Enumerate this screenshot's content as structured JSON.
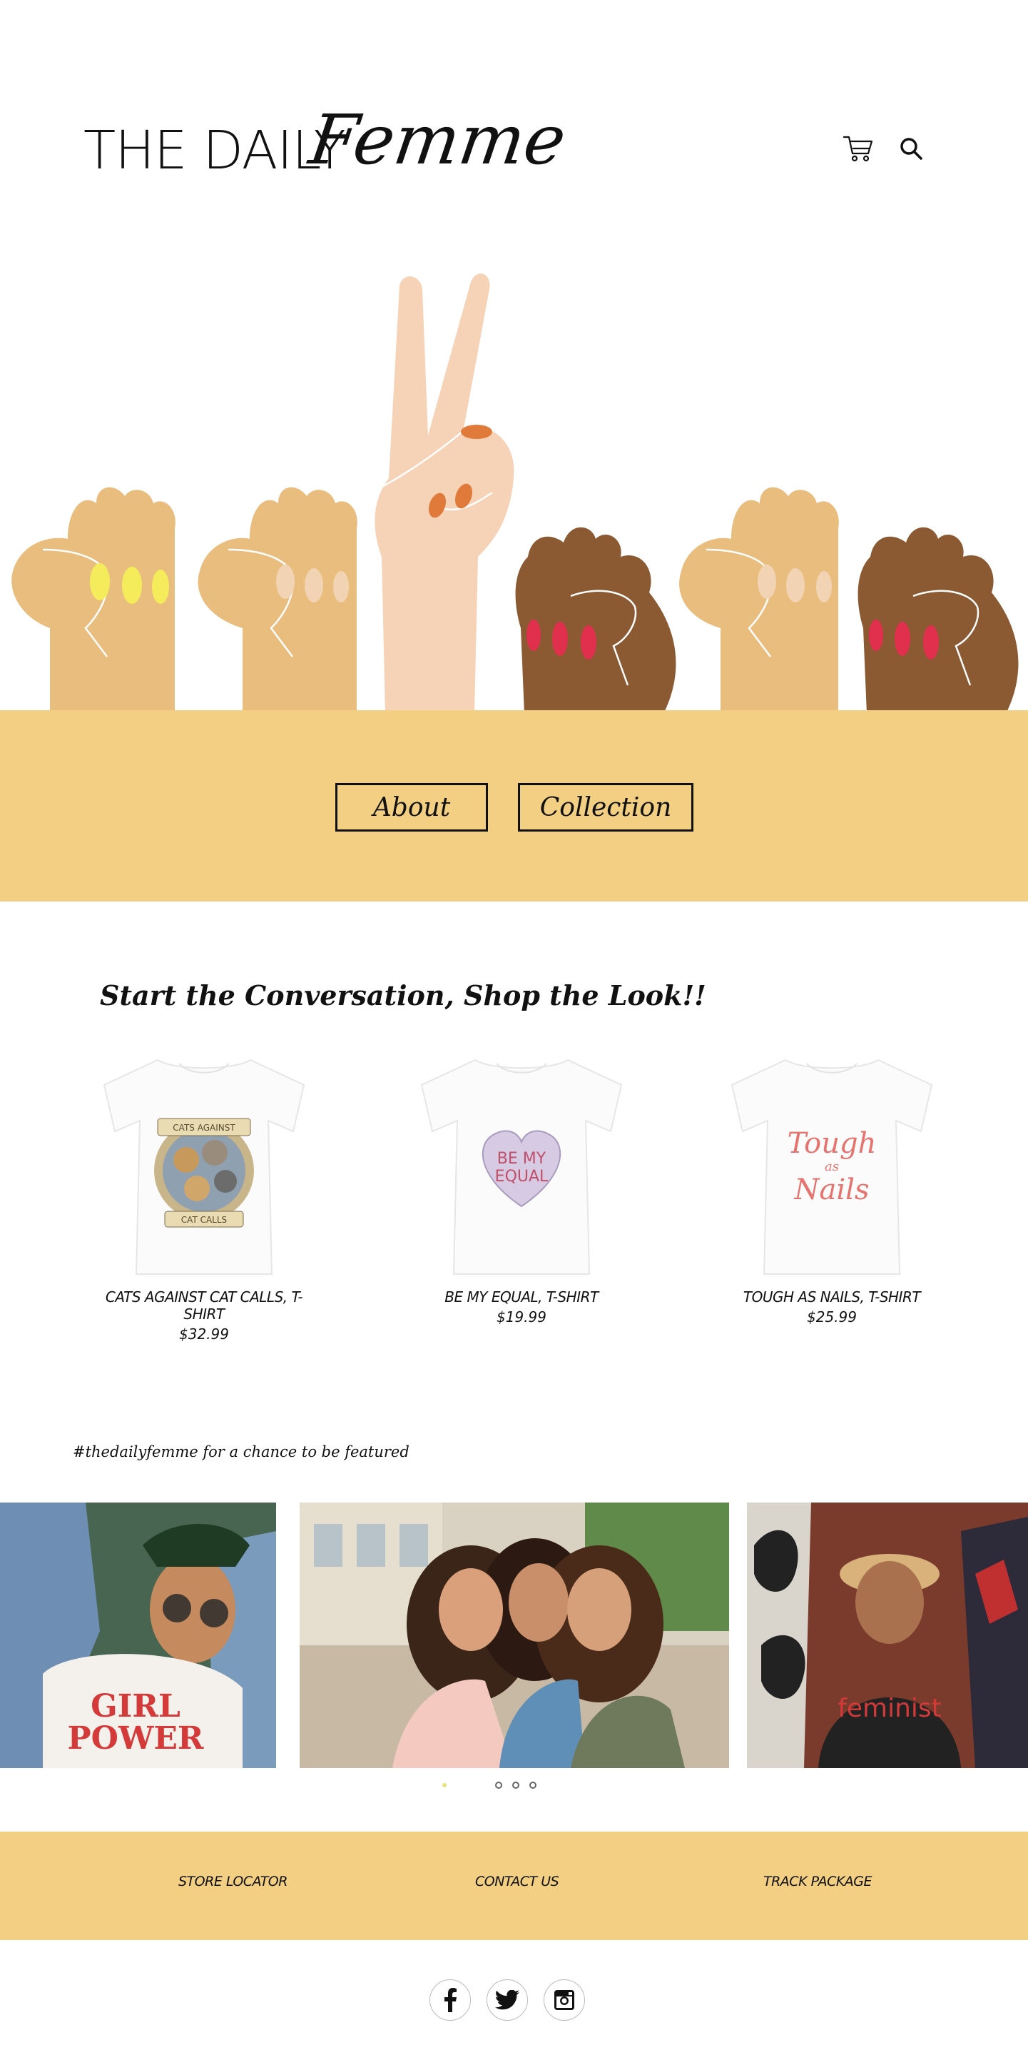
{
  "brand": {
    "logo_sans": "THE DAILY",
    "logo_script": "Femme"
  },
  "header": {
    "icons": [
      "cart-icon",
      "search-icon"
    ]
  },
  "colors": {
    "accent_band": "#f2cf82",
    "text": "#111111"
  },
  "band": {
    "about_label": "About",
    "collection_label": "Collection"
  },
  "shop": {
    "heading": "Start the Conversation, Shop the Look!!",
    "products": [
      {
        "name": "CATS AGAINST CAT CALLS, T-SHIRT",
        "price": "$32.99",
        "print_top": "CATS AGAINST",
        "print_bottom": "CAT CALLS"
      },
      {
        "name": "BE MY EQUAL, T-SHIRT",
        "price": "$19.99",
        "print_top": "BE MY",
        "print_bottom": "EQUAL"
      },
      {
        "name": "TOUGH AS NAILS, T-SHIRT",
        "price": "$25.99",
        "print_top": "Tough",
        "print_mid": "as",
        "print_bottom": "Nails"
      }
    ]
  },
  "featured": {
    "label": "#thedailyfemme for a chance to be featured",
    "photo1_text_top": "GIRL",
    "photo1_text_bottom": "POWER",
    "photo3_text": "feminist",
    "carousel_count": 4,
    "carousel_active": 0
  },
  "footer": {
    "links": [
      "STORE LOCATOR",
      "CONTACT US",
      "TRACK PACKAGE"
    ],
    "socials": [
      "facebook-icon",
      "twitter-icon",
      "instagram-icon"
    ]
  }
}
